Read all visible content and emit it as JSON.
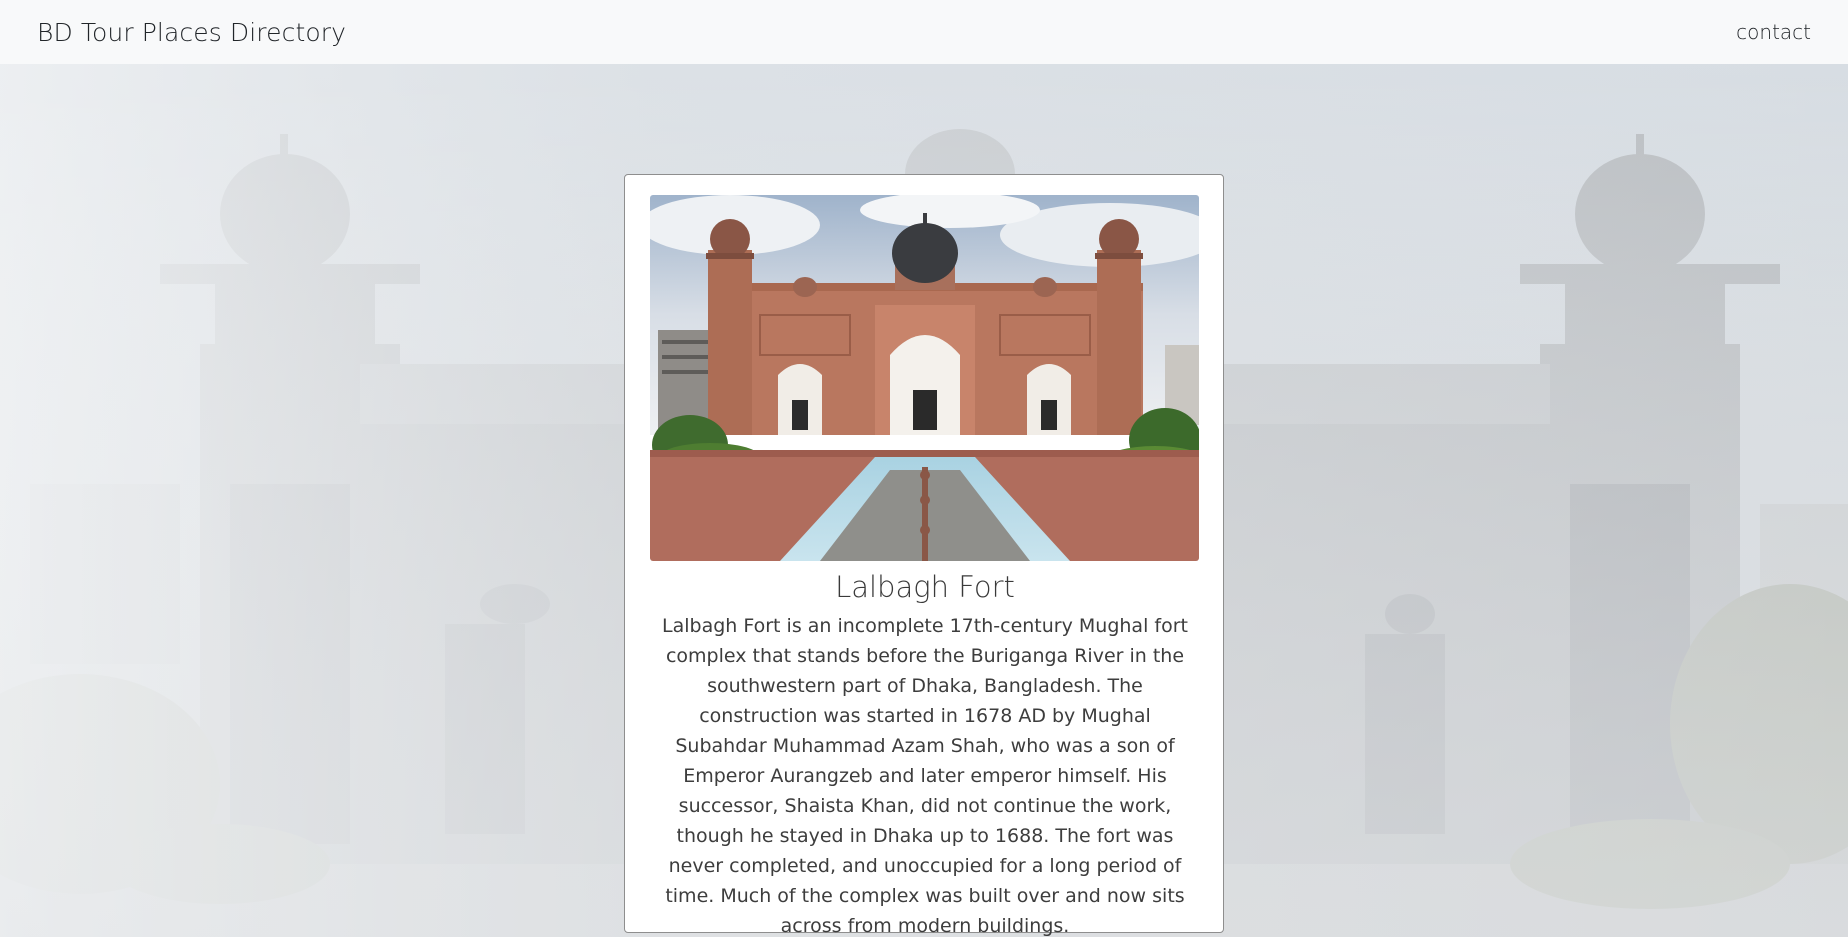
{
  "navbar": {
    "brand": "BD Tour Places Directory",
    "contact_label": "contact"
  },
  "card": {
    "title": "Lalbagh Fort",
    "description": "Lalbagh Fort is an incomplete 17th-century Mughal fort complex that stands before the Buriganga River in the southwestern part of Dhaka, Bangladesh. The construction was started in 1678 AD by Mughal Subahdar Muhammad Azam Shah, who was a son of Emperor Aurangzeb and later emperor himself. His successor, Shaista Khan, did not continue the work, though he stayed in Dhaka up to 1688. The fort was never completed, and unoccupied for a long period of time. Much of the complex was built over and now sits across from modern buildings."
  },
  "colors": {
    "navbar_bg": "#f8f9fa",
    "card_bg": "#ffffff",
    "fort_brick": "#b9775f",
    "text": "#3d3d3d"
  }
}
